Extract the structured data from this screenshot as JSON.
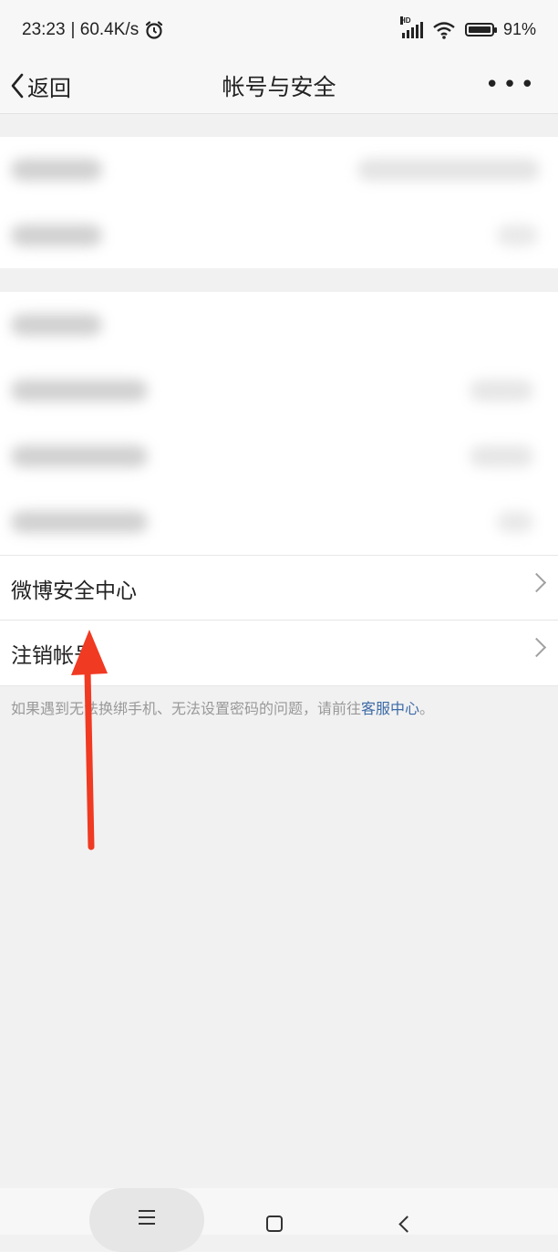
{
  "status_bar": {
    "time": "23:23",
    "network_speed": "| 60.4K/s",
    "alarm_icon": "alarm-clock-icon",
    "hd_label": "HD",
    "battery": "91%"
  },
  "nav": {
    "back_label": "返回",
    "title": "帐号与安全",
    "more_label": "•••"
  },
  "list": {
    "items": [
      {
        "label": "微博安全中心"
      },
      {
        "label": "注销帐号"
      }
    ]
  },
  "note": {
    "text": "如果遇到无法换绑手机、无法设置密码的问题，请前往",
    "link": "客服中心",
    "tail": "。"
  },
  "colors": {
    "accent_link": "#3c6aa6",
    "annotation_arrow": "#f03a22"
  }
}
